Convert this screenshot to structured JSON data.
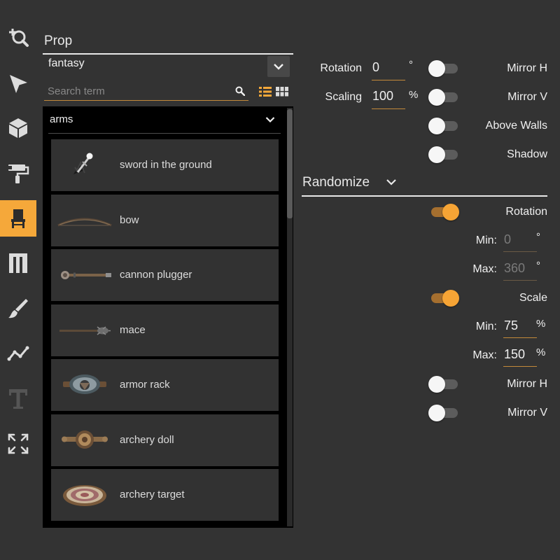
{
  "toolbar": {
    "tools": [
      {
        "name": "zoom-tool",
        "icon": "zoom-in-icon"
      },
      {
        "name": "select-tool",
        "icon": "pointer-icon"
      },
      {
        "name": "object-tool",
        "icon": "cube-icon"
      },
      {
        "name": "paint-tool",
        "icon": "paint-roller-icon"
      },
      {
        "name": "prop-tool",
        "icon": "chair-icon",
        "active": true
      },
      {
        "name": "wall-tool",
        "icon": "wall-icon"
      },
      {
        "name": "brush-tool",
        "icon": "brush-icon"
      },
      {
        "name": "path-tool",
        "icon": "path-icon"
      },
      {
        "name": "text-tool",
        "icon": "text-icon",
        "disabled": true
      },
      {
        "name": "fit-tool",
        "icon": "expand-icon"
      }
    ],
    "active_color": "#f5a83a"
  },
  "prop_panel": {
    "title": "Prop",
    "pack": "fantasy",
    "search": {
      "placeholder": "Search term",
      "value": ""
    },
    "group": "arms",
    "items": [
      {
        "label": "sword in the ground",
        "icon": "sword-in-ground-icon"
      },
      {
        "label": "bow",
        "icon": "bow-icon"
      },
      {
        "label": "cannon plugger",
        "icon": "cannon-plugger-icon"
      },
      {
        "label": "mace",
        "icon": "mace-icon"
      },
      {
        "label": "armor rack",
        "icon": "armor-rack-icon"
      },
      {
        "label": "archery doll",
        "icon": "archery-doll-icon"
      },
      {
        "label": "archery target",
        "icon": "archery-target-icon"
      }
    ]
  },
  "settings": {
    "rotation": {
      "label": "Rotation",
      "value": "0",
      "unit": "°"
    },
    "scaling": {
      "label": "Scaling",
      "value": "100",
      "unit": "%"
    },
    "mirror_h": {
      "label": "Mirror H",
      "on": false
    },
    "mirror_v": {
      "label": "Mirror V",
      "on": false
    },
    "above_walls": {
      "label": "Above Walls",
      "on": false
    },
    "shadow": {
      "label": "Shadow",
      "on": false
    }
  },
  "randomize": {
    "title": "Randomize",
    "rotation": {
      "label": "Rotation",
      "on": true,
      "min_label": "Min:",
      "min": "0",
      "max_label": "Max:",
      "max": "360",
      "unit": "°"
    },
    "scale": {
      "label": "Scale",
      "on": true,
      "min_label": "Min:",
      "min": "75",
      "max_label": "Max:",
      "max": "150",
      "unit": "%"
    },
    "mirror_h": {
      "label": "Mirror H",
      "on": false
    },
    "mirror_v": {
      "label": "Mirror V",
      "on": false
    }
  },
  "colors": {
    "accent": "#f5a83a",
    "background": "#333333",
    "list_bg": "#000000"
  }
}
